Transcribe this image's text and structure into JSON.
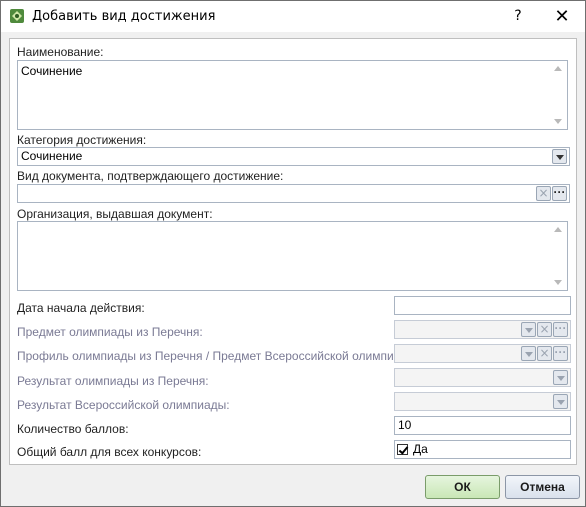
{
  "window": {
    "title": "Добавить вид достижения",
    "help": "?",
    "close": "✕"
  },
  "form": {
    "name_label": "Наименование:",
    "name_value": "Сочинение",
    "category_label": "Категория достижения:",
    "category_value": "Сочинение",
    "doc_type_label": "Вид документа, подтверждающего достижение:",
    "doc_type_value": "",
    "org_label": "Организация, выдавшая документ:",
    "org_value": "",
    "start_date_label": "Дата начала действия:",
    "start_date_value": "",
    "olymp_subject_label": "Предмет олимпиады из Перечня:",
    "olymp_profile_label": "Профиль олимпиады из Перечня / Предмет Всероссийской олимпиады:",
    "olymp_result_label": "Результат олимпиады из Перечня:",
    "vseros_result_label": "Результат Всероссийской олимпиады:",
    "points_label": "Количество баллов:",
    "points_value": "10",
    "total_score_label": "Общий балл для всех конкурсов:",
    "total_score_checked": true,
    "total_score_text": "Да"
  },
  "buttons": {
    "ok": "ОК",
    "cancel": "Отмена"
  },
  "icons": {
    "app": "app-icon",
    "help": "help-icon",
    "close": "close-icon",
    "dropdown": "chevron-down-icon",
    "clear": "clear-icon",
    "ellipsis": "ellipsis-icon",
    "check": "check-icon"
  },
  "colors": {
    "ok_button": "#c9e7b6",
    "disabled_label": "#7a7a94"
  }
}
